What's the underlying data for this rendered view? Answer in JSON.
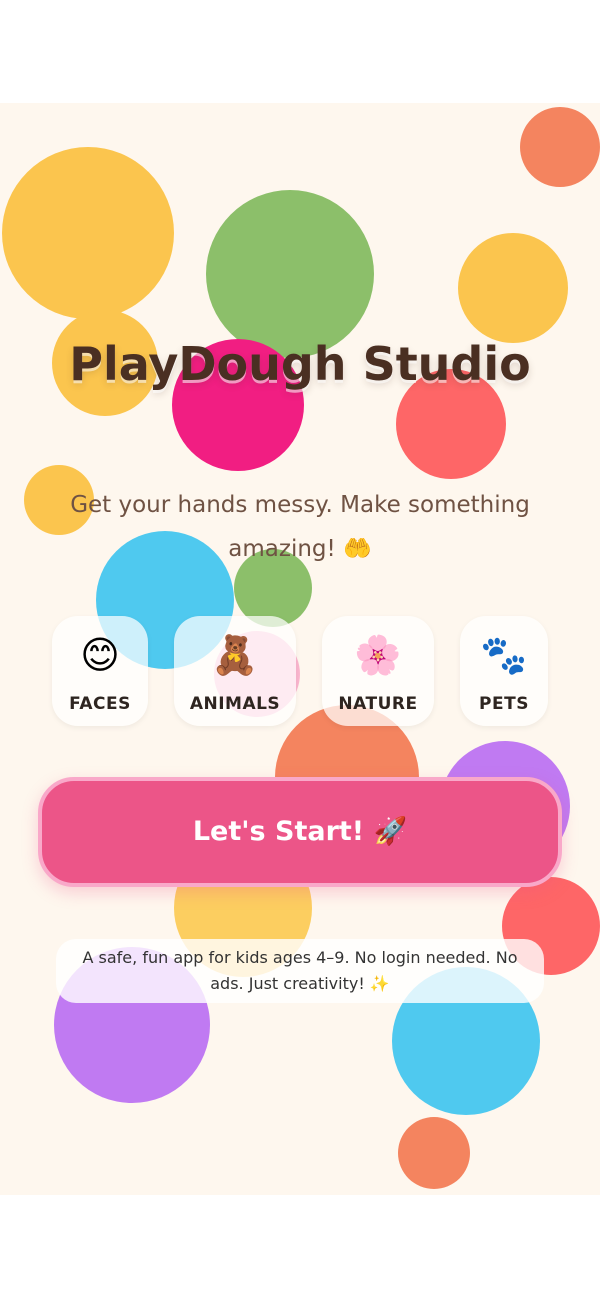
{
  "app": {
    "title": "PlayDough Studio",
    "subtitle": "Get your hands messy. Make something amazing! 🤲",
    "categories": [
      {
        "emoji": "😊",
        "label": "FACES",
        "icon": "smiling-face-icon"
      },
      {
        "emoji": "🧸",
        "label": "ANIMALS",
        "icon": "teddy-bear-icon"
      },
      {
        "emoji": "🌸",
        "label": "NATURE",
        "icon": "cherry-blossom-icon"
      },
      {
        "emoji": "🐾",
        "label": "PETS",
        "icon": "paw-prints-icon"
      }
    ],
    "start_button": "Let's Start! 🚀",
    "note": "A safe, fun app for kids ages 4–9. No login needed. No ads. Just creativity! ✨"
  },
  "colors": {
    "background": "#fef7ee",
    "title": "#4a2f22",
    "subtitle": "#6f5243",
    "start_button": "#ec5588",
    "start_button_border": "#f9a8c9",
    "blob_yellow": "#fbc54e",
    "blob_green": "#8cbf6a",
    "blob_orange": "#f4845f",
    "blob_red": "#fe6667",
    "blob_pink": "#f11e82",
    "blob_blue": "#4fc9ef",
    "blob_purple": "#c07af2"
  }
}
